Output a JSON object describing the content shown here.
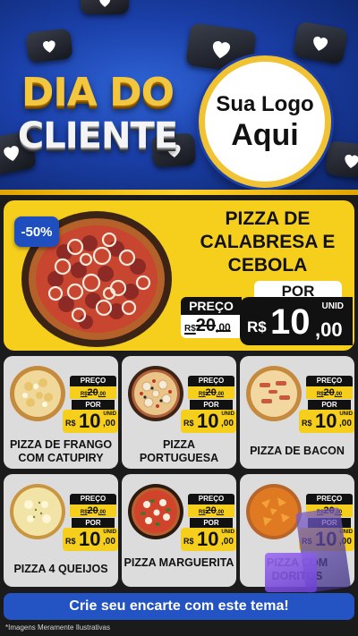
{
  "header": {
    "title_line1": "DIA DO",
    "title_line2": "CLIENTE",
    "logo_line1": "Sua Logo",
    "logo_line2": "Aqui"
  },
  "featured": {
    "discount": "-50%",
    "name": "PIZZA DE CALABRESA E CEBOLA",
    "old_price_label": "PREÇO",
    "old_price_currency": "R$",
    "old_price_int": "20",
    "old_price_dec": ",00",
    "por_label": "POR",
    "unit_label": "UNID",
    "currency": "R$",
    "price_int": "10",
    "price_dec": ",00"
  },
  "products": [
    {
      "name": "PIZZA DE FRANGO COM CATUPIRY",
      "old_label": "PREÇO",
      "old_currency": "R$",
      "old_int": "20",
      "old_dec": ",00",
      "por": "POR",
      "currency": "R$",
      "price_int": "10",
      "price_dec": ",00",
      "unit": "UNID"
    },
    {
      "name": "PIZZA PORTUGUESA",
      "old_label": "PREÇO",
      "old_currency": "R$",
      "old_int": "20",
      "old_dec": ",00",
      "por": "POR",
      "currency": "R$",
      "price_int": "10",
      "price_dec": ",00",
      "unit": "UNID"
    },
    {
      "name": "PIZZA DE BACON",
      "old_label": "PREÇO",
      "old_currency": "R$",
      "old_int": "20",
      "old_dec": ",00",
      "por": "POR",
      "currency": "R$",
      "price_int": "10",
      "price_dec": ",00",
      "unit": "UNID"
    },
    {
      "name": "PIZZA 4 QUEIJOS",
      "old_label": "PREÇO",
      "old_currency": "R$",
      "old_int": "20",
      "old_dec": ",00",
      "por": "POR",
      "currency": "R$",
      "price_int": "10",
      "price_dec": ",00",
      "unit": "UNID"
    },
    {
      "name": "PIZZA MARGUERITA",
      "old_label": "PREÇO",
      "old_currency": "R$",
      "old_int": "20",
      "old_dec": ",00",
      "por": "POR",
      "currency": "R$",
      "price_int": "10",
      "price_dec": ",00",
      "unit": "UNID"
    },
    {
      "name": "PIZZA COM DORITOS",
      "old_label": "PREÇO",
      "old_currency": "R$",
      "old_int": "20",
      "old_dec": ",00",
      "por": "POR",
      "currency": "R$",
      "price_int": "10",
      "price_dec": ",00",
      "unit": "UNID"
    }
  ],
  "cta_label": "Crie seu encarte com este tema!",
  "disclaimer": "*Imagens Meramente Ilustrativas",
  "colors": {
    "brand_blue": "#1a3fa8",
    "accent_yellow": "#f5cf1c",
    "card_gray": "#dcdcdc",
    "dark": "#111111"
  },
  "icons": [
    "heart-icon"
  ]
}
